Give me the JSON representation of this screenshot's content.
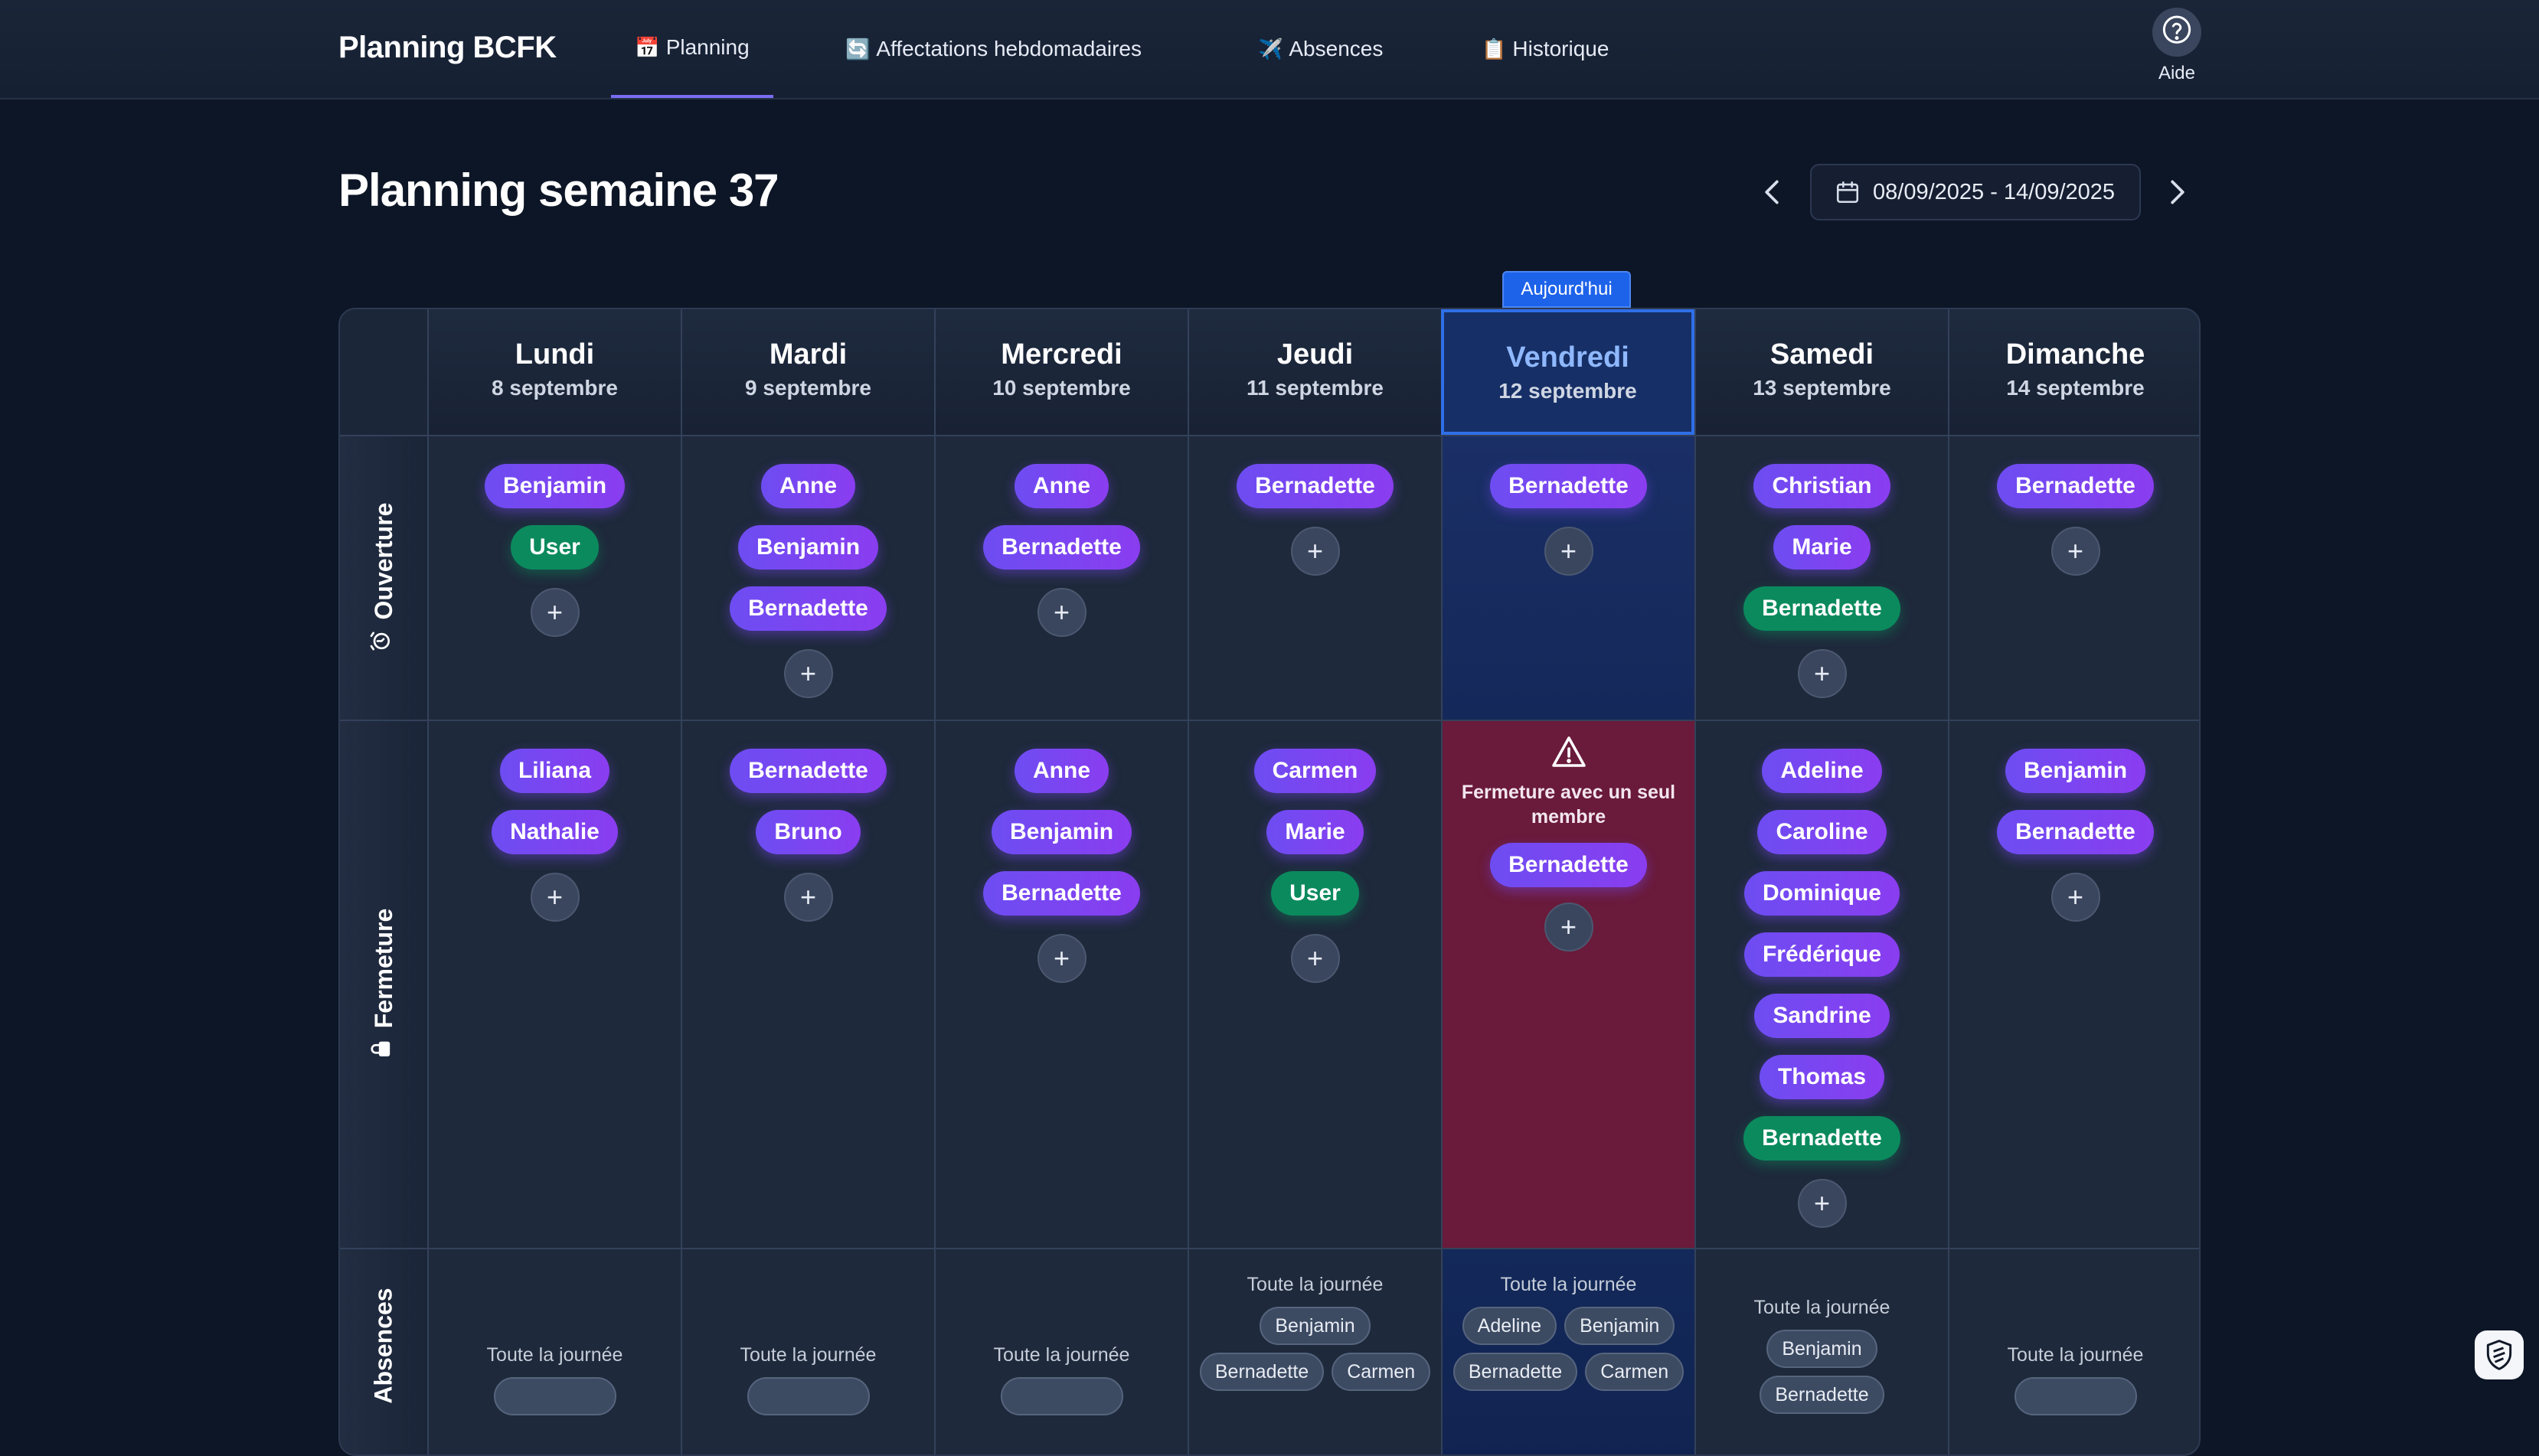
{
  "nav": {
    "brand": "Planning BCFK",
    "tabs": [
      {
        "emoji": "📅",
        "label": "Planning"
      },
      {
        "emoji": "🔄",
        "label": "Affectations hebdomadaires"
      },
      {
        "emoji": "✈️",
        "label": "Absences"
      },
      {
        "emoji": "📋",
        "label": "Historique"
      }
    ],
    "help_label": "Aide"
  },
  "header": {
    "title": "Planning semaine 37",
    "date_range": "08/09/2025 - 14/09/2025"
  },
  "today_badge": "Aujourd'hui",
  "days": [
    {
      "name": "Lundi",
      "date": "8 septembre"
    },
    {
      "name": "Mardi",
      "date": "9 septembre"
    },
    {
      "name": "Mercredi",
      "date": "10 septembre"
    },
    {
      "name": "Jeudi",
      "date": "11 septembre"
    },
    {
      "name": "Vendredi",
      "date": "12 septembre"
    },
    {
      "name": "Samedi",
      "date": "13 septembre"
    },
    {
      "name": "Dimanche",
      "date": "14 septembre"
    }
  ],
  "rows": {
    "ouverture": {
      "label": "Ouverture",
      "icon": "alarm-clock-icon"
    },
    "fermeture": {
      "label": "Fermeture",
      "icon": "lock-icon"
    },
    "absences": {
      "label": "Absences"
    }
  },
  "ouverture": [
    [
      {
        "name": "Benjamin",
        "color": "purple"
      },
      {
        "name": "User",
        "color": "green"
      }
    ],
    [
      {
        "name": "Anne",
        "color": "purple"
      },
      {
        "name": "Benjamin",
        "color": "purple"
      },
      {
        "name": "Bernadette",
        "color": "purple"
      }
    ],
    [
      {
        "name": "Anne",
        "color": "purple"
      },
      {
        "name": "Bernadette",
        "color": "purple"
      }
    ],
    [
      {
        "name": "Bernadette",
        "color": "purple"
      }
    ],
    [
      {
        "name": "Bernadette",
        "color": "purple"
      }
    ],
    [
      {
        "name": "Christian",
        "color": "purple"
      },
      {
        "name": "Marie",
        "color": "purple"
      },
      {
        "name": "Bernadette",
        "color": "green"
      }
    ],
    [
      {
        "name": "Bernadette",
        "color": "purple"
      }
    ]
  ],
  "fermeture": [
    [
      {
        "name": "Liliana",
        "color": "purple"
      },
      {
        "name": "Nathalie",
        "color": "purple"
      }
    ],
    [
      {
        "name": "Bernadette",
        "color": "purple"
      },
      {
        "name": "Bruno",
        "color": "purple"
      }
    ],
    [
      {
        "name": "Anne",
        "color": "purple"
      },
      {
        "name": "Benjamin",
        "color": "purple"
      },
      {
        "name": "Bernadette",
        "color": "purple"
      }
    ],
    [
      {
        "name": "Carmen",
        "color": "purple"
      },
      {
        "name": "Marie",
        "color": "purple"
      },
      {
        "name": "User",
        "color": "green"
      }
    ],
    [
      {
        "name": "Bernadette",
        "color": "purple"
      }
    ],
    [
      {
        "name": "Adeline",
        "color": "purple"
      },
      {
        "name": "Caroline",
        "color": "purple"
      },
      {
        "name": "Dominique",
        "color": "purple"
      },
      {
        "name": "Frédérique",
        "color": "purple"
      },
      {
        "name": "Sandrine",
        "color": "purple"
      },
      {
        "name": "Thomas",
        "color": "purple"
      },
      {
        "name": "Bernadette",
        "color": "green"
      }
    ],
    [
      {
        "name": "Benjamin",
        "color": "purple"
      },
      {
        "name": "Bernadette",
        "color": "purple"
      }
    ]
  ],
  "fermeture_alert": "Fermeture avec un seul membre",
  "absences": [
    {
      "label": "Toute la journée",
      "names": []
    },
    {
      "label": "Toute la journée",
      "names": []
    },
    {
      "label": "Toute la journée",
      "names": []
    },
    {
      "label": "Toute la journée",
      "names": [
        "Benjamin",
        "Bernadette",
        "Carmen"
      ]
    },
    {
      "label": "Toute la journée",
      "names": [
        "Adeline",
        "Benjamin",
        "Bernadette",
        "Carmen"
      ]
    },
    {
      "label": "Toute la journée",
      "names": [
        "Benjamin",
        "Bernadette"
      ]
    },
    {
      "label": "Toute la journée",
      "names": []
    }
  ],
  "add_symbol": "+",
  "colors": {
    "accent": "#7a6cf0",
    "today": "#2f6fe8",
    "alert": "#6a1a3a",
    "pill_purple": "#7b45f1",
    "pill_green": "#0b8a5e"
  }
}
